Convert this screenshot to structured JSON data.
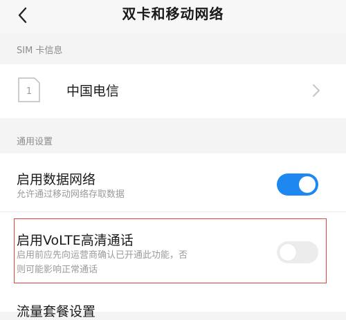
{
  "header": {
    "title": "双卡和移动网络",
    "back_icon": "chevron-left-icon"
  },
  "sim_section": {
    "label": "SIM 卡信息",
    "sim_card": {
      "slot_number": "1",
      "carrier": "中国电信",
      "chevron_icon": "chevron-right-icon"
    }
  },
  "general_section": {
    "label": "通用设置",
    "mobile_data": {
      "title": "启用数据网络",
      "subtitle": "允许通过移动网络存取数据",
      "enabled": true
    },
    "volte": {
      "title": "启用VoLTE高清通话",
      "subtitle_line1": "启用前应先向运营商确认已开通此功能，否",
      "subtitle_line2": "则可能影响正常通话",
      "enabled": false
    },
    "data_plan": {
      "title": "流量套餐设置"
    }
  },
  "colors": {
    "toggle_on": "#1e88f0",
    "toggle_off": "#ececec",
    "highlight_border": "#e0443c"
  }
}
